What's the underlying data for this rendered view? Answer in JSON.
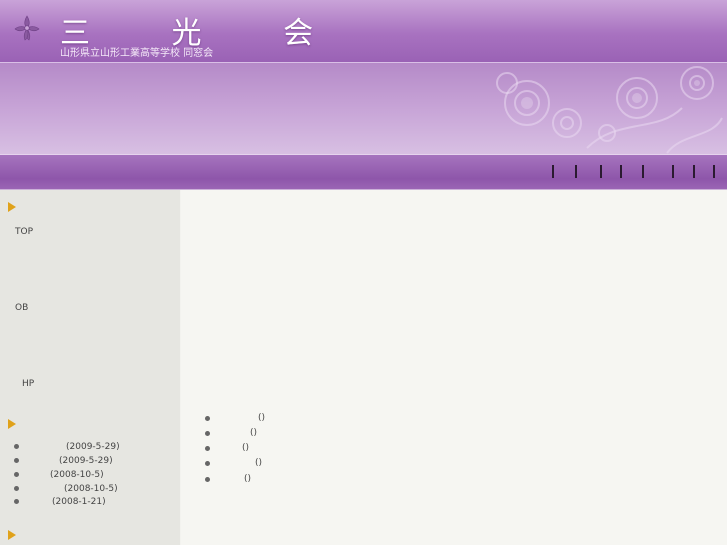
{
  "header": {
    "title": "三 光 会",
    "subtitle": "山形県立山形工業高等学校 同窓会",
    "logo_icon": "flower-crest-icon"
  },
  "nav": {
    "separator_count": 8
  },
  "sidebar": {
    "menu": [
      {
        "label": "TOP"
      },
      {
        "label": "OB"
      },
      {
        "label": "HP"
      }
    ],
    "news": [
      {
        "date": "(2009-5-29)"
      },
      {
        "date": "(2009-5-29)"
      },
      {
        "date": "(2008-10-5)"
      },
      {
        "date": "(2008-10-5)"
      },
      {
        "date": "(2008-1-21)"
      }
    ]
  },
  "main": {
    "items": [
      {
        "text": "()"
      },
      {
        "text": "()"
      },
      {
        "text": "()"
      },
      {
        "text": "()"
      },
      {
        "text": "()"
      }
    ]
  },
  "colors": {
    "header_purple": "#a872c0",
    "nav_purple": "#8e56aa",
    "arrow_orange": "#e0a21a",
    "sidebar_bg": "#e6e6e1",
    "main_bg": "#f6f6f2"
  }
}
